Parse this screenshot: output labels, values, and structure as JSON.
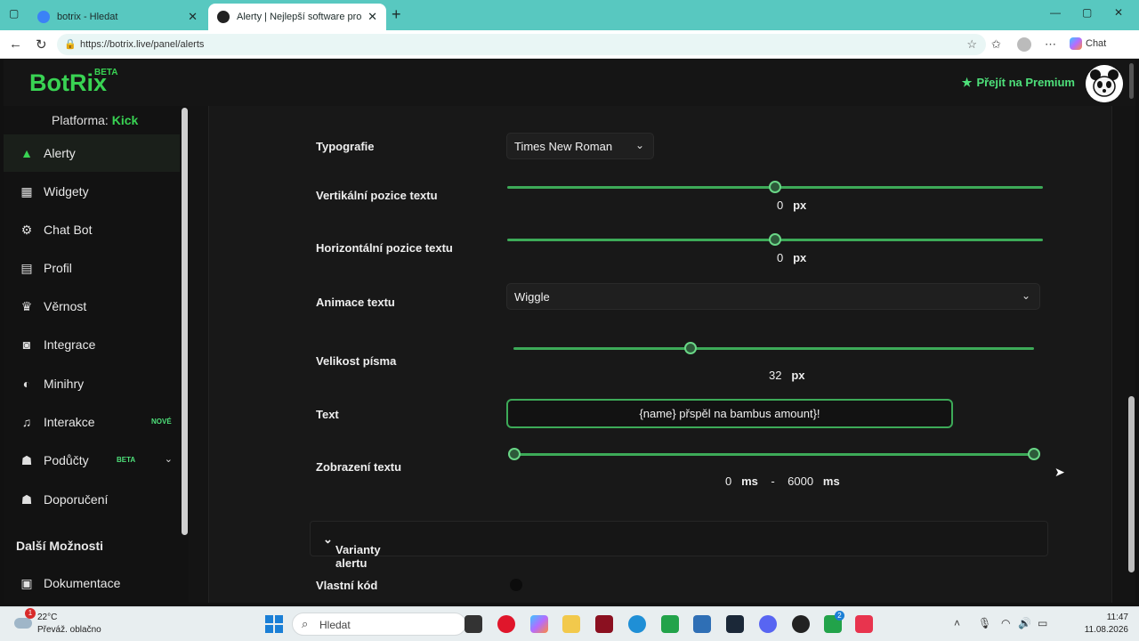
{
  "browser": {
    "tabs": [
      {
        "title": "botrix - Hledat",
        "active": false
      },
      {
        "title": "Alerty | Nejlepší software pro vylep",
        "active": true
      }
    ],
    "url": "https://botrix.live/panel/alerts",
    "chat_label": "Chat"
  },
  "app": {
    "logo": "BotRix",
    "logo_badge": "BETA",
    "premium_label": "Přejít na Premium",
    "accent_color": "#39d353"
  },
  "sidebar": {
    "platform_label": "Platforma:",
    "platform_value": "Kick",
    "items": [
      {
        "label": "Alerty",
        "icon": "warning-icon",
        "active": true
      },
      {
        "label": "Widgety",
        "icon": "grid-icon"
      },
      {
        "label": "Chat Bot",
        "icon": "robot-icon"
      },
      {
        "label": "Profil",
        "icon": "id-card-icon"
      },
      {
        "label": "Věrnost",
        "icon": "trophy-icon"
      },
      {
        "label": "Integrace",
        "icon": "discord-icon"
      },
      {
        "label": "Minihry",
        "icon": "gamepad-icon"
      },
      {
        "label": "Interakce",
        "icon": "music-icon",
        "badge": "NOVÉ"
      },
      {
        "label": "Podůčty",
        "icon": "users-icon",
        "badge": "BETA"
      },
      {
        "label": "Doporučení",
        "icon": "users-icon"
      }
    ],
    "section_title": "Další Možnosti",
    "extra_items": [
      {
        "label": "Dokumentace",
        "icon": "book-icon"
      }
    ]
  },
  "form": {
    "typography": {
      "label": "Typografie",
      "value": "Times New Roman"
    },
    "vertical_pos": {
      "label": "Vertikální pozice textu",
      "value": "0",
      "unit": "px",
      "level": 0.5
    },
    "horizontal_pos": {
      "label": "Horizontální pozice textu",
      "value": "0",
      "unit": "px",
      "level": 0.5
    },
    "animation": {
      "label": "Animace textu",
      "value": "Wiggle"
    },
    "font_size": {
      "label": "Velikost písma",
      "value": "32",
      "unit": "px",
      "level": 0.34
    },
    "text": {
      "label": "Text",
      "value": "{name} přspěl na bambus amount}!"
    },
    "display": {
      "label": "Zobrazení textu",
      "min": "0",
      "max": "6000",
      "unit": "ms",
      "separator": "-"
    },
    "variants_label": "Varianty alertu",
    "custom_code_label": "Vlastní kód"
  },
  "taskbar": {
    "temp": "22°C",
    "condition": "Převáž. oblačno",
    "notif_count": "1",
    "search_placeholder": "Hledat",
    "time": "11:47",
    "date": "11.08.2026",
    "xbox_badge": "2"
  }
}
